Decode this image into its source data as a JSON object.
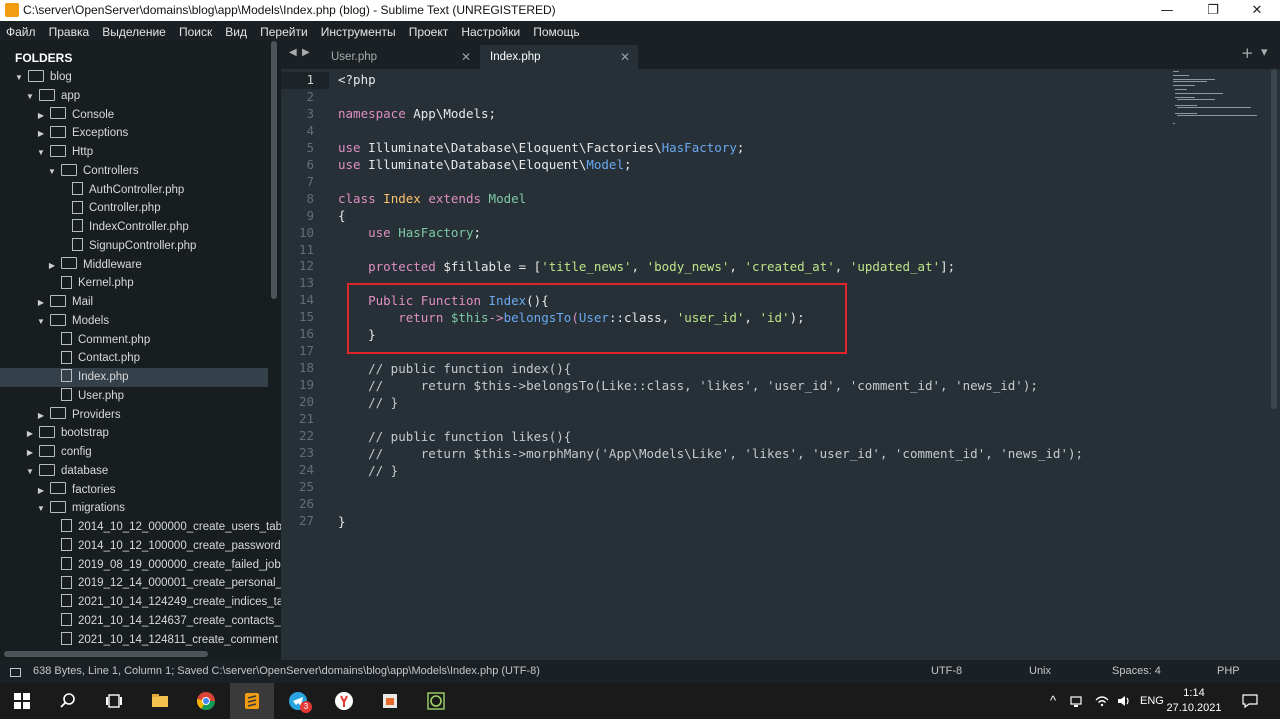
{
  "window": {
    "title": "C:\\server\\OpenServer\\domains\\blog\\app\\Models\\Index.php (blog) - Sublime Text (UNREGISTERED)",
    "minimize": "—",
    "maximize": "❐",
    "close": "✕"
  },
  "menu": [
    "Файл",
    "Правка",
    "Выделение",
    "Поиск",
    "Вид",
    "Перейти",
    "Инструменты",
    "Проект",
    "Настройки",
    "Помощь"
  ],
  "sidebar": {
    "title": "FOLDERS",
    "items": [
      {
        "label": "blog",
        "type": "folder",
        "open": true
      },
      {
        "label": "app",
        "type": "folder",
        "open": true
      },
      {
        "label": "Console",
        "type": "folder",
        "open": false
      },
      {
        "label": "Exceptions",
        "type": "folder",
        "open": false
      },
      {
        "label": "Http",
        "type": "folder",
        "open": true
      },
      {
        "label": "Controllers",
        "type": "folder",
        "open": true
      },
      {
        "label": "AuthController.php",
        "type": "file"
      },
      {
        "label": "Controller.php",
        "type": "file"
      },
      {
        "label": "IndexController.php",
        "type": "file"
      },
      {
        "label": "SignupController.php",
        "type": "file"
      },
      {
        "label": "Middleware",
        "type": "folder",
        "open": false
      },
      {
        "label": "Kernel.php",
        "type": "file"
      },
      {
        "label": "Mail",
        "type": "folder",
        "open": false
      },
      {
        "label": "Models",
        "type": "folder",
        "open": true
      },
      {
        "label": "Comment.php",
        "type": "file"
      },
      {
        "label": "Contact.php",
        "type": "file"
      },
      {
        "label": "Index.php",
        "type": "file",
        "selected": true
      },
      {
        "label": "User.php",
        "type": "file"
      },
      {
        "label": "Providers",
        "type": "folder",
        "open": false
      },
      {
        "label": "bootstrap",
        "type": "folder",
        "open": false
      },
      {
        "label": "config",
        "type": "folder",
        "open": false
      },
      {
        "label": "database",
        "type": "folder",
        "open": true
      },
      {
        "label": "factories",
        "type": "folder",
        "open": false
      },
      {
        "label": "migrations",
        "type": "folder",
        "open": true
      },
      {
        "label": "2014_10_12_000000_create_users_tab",
        "type": "file"
      },
      {
        "label": "2014_10_12_100000_create_password",
        "type": "file"
      },
      {
        "label": "2019_08_19_000000_create_failed_job",
        "type": "file"
      },
      {
        "label": "2019_12_14_000001_create_personal_",
        "type": "file"
      },
      {
        "label": "2021_10_14_124249_create_indices_ta",
        "type": "file"
      },
      {
        "label": "2021_10_14_124637_create_contacts_",
        "type": "file"
      },
      {
        "label": "2021_10_14_124811_create_comment",
        "type": "file"
      }
    ]
  },
  "tabs": [
    {
      "label": "User.php",
      "active": false
    },
    {
      "label": "Index.php",
      "active": true
    }
  ],
  "tab_close": "✕",
  "tab_nav": {
    "left": "◀",
    "right": "▶",
    "add": "+",
    "overflow": "▾"
  },
  "editor": {
    "line_numbers": [
      "1",
      "2",
      "3",
      "4",
      "5",
      "6",
      "7",
      "8",
      "9",
      "10",
      "11",
      "12",
      "13",
      "14",
      "15",
      "16",
      "17",
      "18",
      "19",
      "20",
      "21",
      "22",
      "23",
      "24",
      "25",
      "26",
      "27"
    ],
    "code": {
      "l1": "<?php",
      "l3_kw": "namespace",
      "l3_ns": " App\\Models;",
      "l5_kw": "use",
      "l5_ns": " Illuminate\\Database\\Eloquent\\Factories\\",
      "l5_cls": "HasFactory",
      "l5_end": ";",
      "l6_kw": "use",
      "l6_ns": " Illuminate\\Database\\Eloquent\\",
      "l6_cls": "Model",
      "l6_end": ";",
      "l8_kw1": "class",
      "l8_cls": " Index",
      "l8_kw2": " extends",
      "l8_par": " Model",
      "l9": "{",
      "l10_kw": "    use",
      "l10_cls": " HasFactory",
      "l10_end": ";",
      "l12_kw": "    protected",
      "l12_var": " $fillable",
      "l12_op": " = [",
      "l12_s1": "'title_news'",
      "l12_c1": ", ",
      "l12_s2": "'body_news'",
      "l12_c2": ", ",
      "l12_s3": "'created_at'",
      "l12_c3": ", ",
      "l12_s4": "'updated_at'",
      "l12_end": "];",
      "l14_kw1": "    Public",
      "l14_kw2": " Function",
      "l14_fn": " Index",
      "l14_end": "(){",
      "l15_kw": "        return",
      "l15_var": " $this",
      "l15_arrow": "->",
      "l15_fn": "belongsTo",
      "l15_p": "(",
      "l15_cls": "User",
      "l15_mid": "::class, ",
      "l15_s1": "'user_id'",
      "l15_c": ", ",
      "l15_s2": "'id'",
      "l15_end": ");",
      "l16": "    }",
      "l18": "    // public function index(){",
      "l19": "    //     return $this->belongsTo(Like::class, 'likes', 'user_id', 'comment_id', 'news_id');",
      "l20": "    // }",
      "l22": "    // public function likes(){",
      "l23": "    //     return $this->morphMany('App\\Models\\Like', 'likes', 'user_id', 'comment_id', 'news_id');",
      "l24": "    // }",
      "l27": "}"
    }
  },
  "status": {
    "info": "638 Bytes, Line 1, Column 1; Saved C:\\server\\OpenServer\\domains\\blog\\app\\Models\\Index.php (UTF-8)",
    "encoding": "UTF-8",
    "line_endings": "Unix",
    "indent": "Spaces: 4",
    "syntax": "PHP"
  },
  "taskbar": {
    "lang": "ENG",
    "time": "1:14",
    "date": "27.10.2021",
    "telegram_badge": "3",
    "tray_up": "^"
  }
}
